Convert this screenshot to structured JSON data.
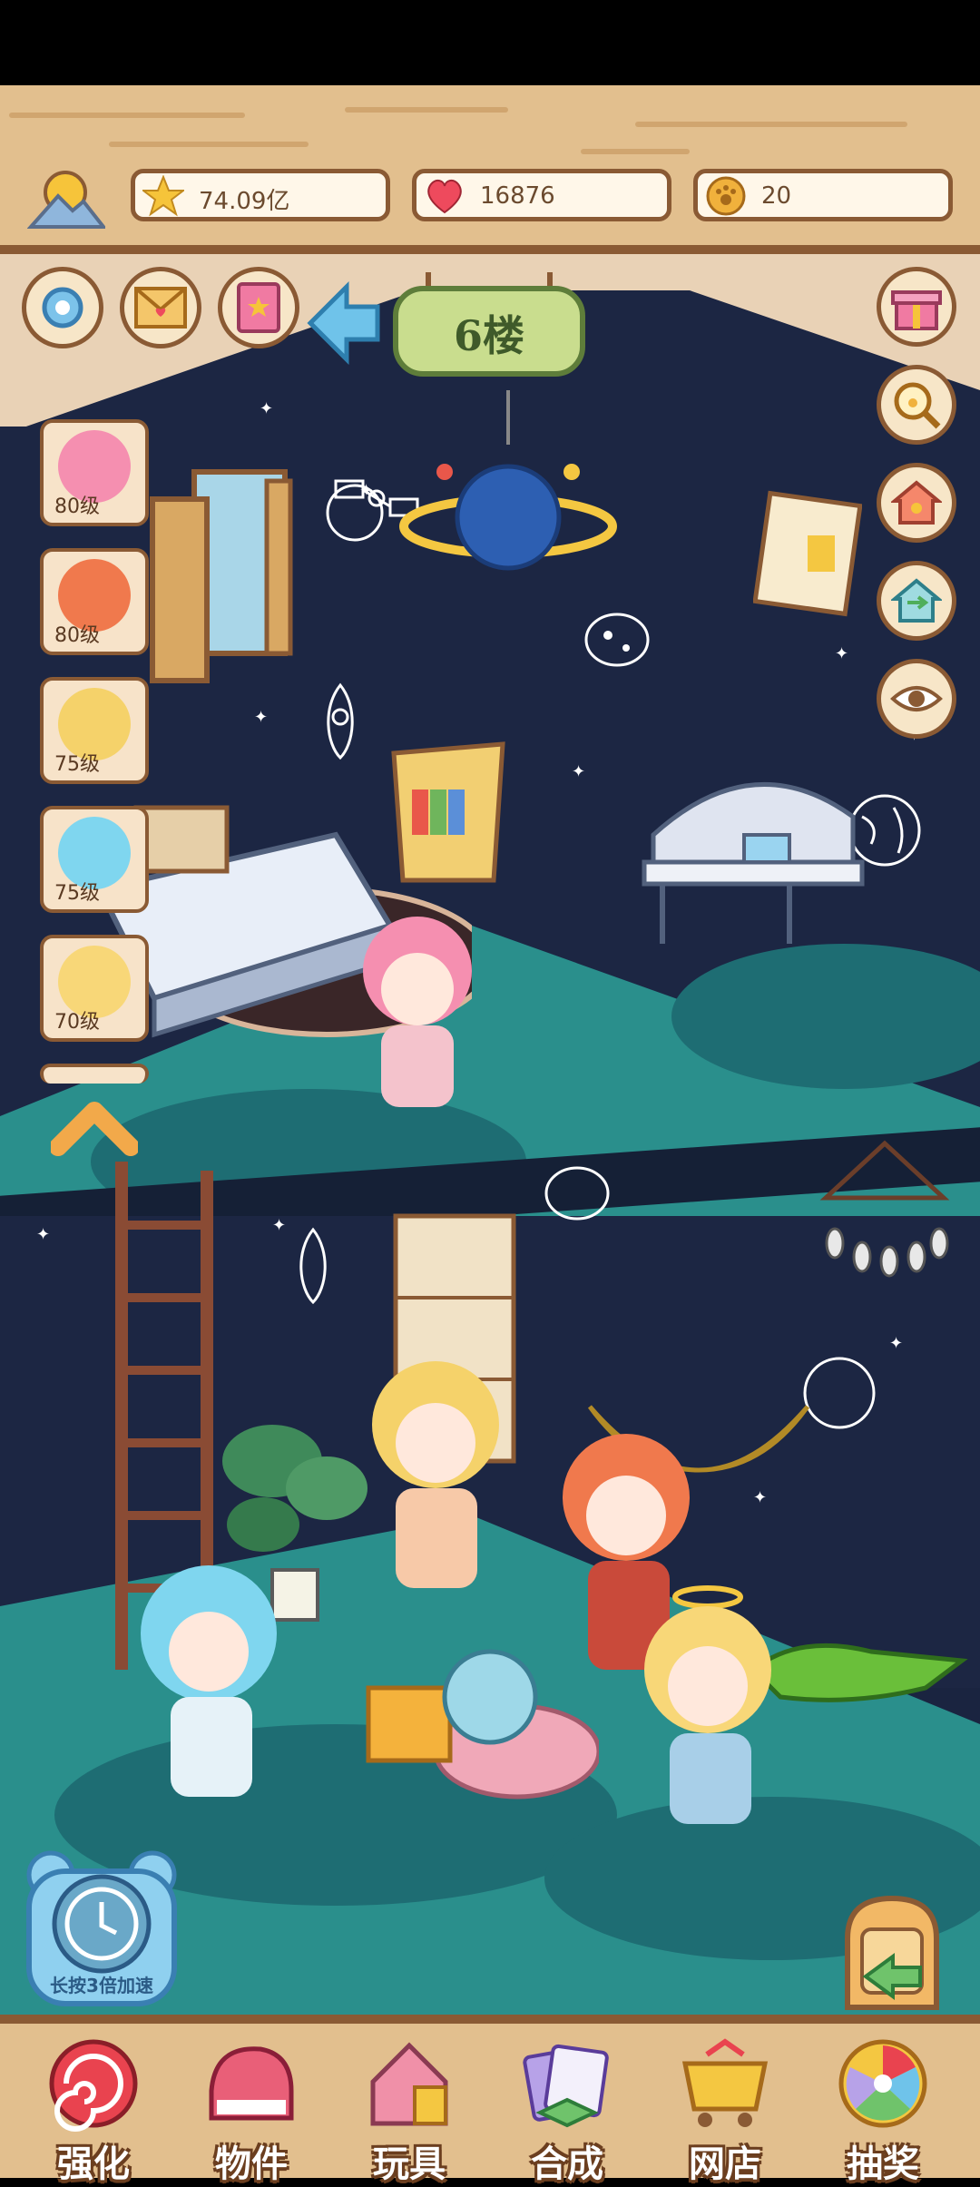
{
  "resources": [
    {
      "name": "stars",
      "icon": "star-icon",
      "value": "74.09亿"
    },
    {
      "name": "hearts",
      "icon": "heart-icon",
      "value": "16876"
    },
    {
      "name": "paw_coins",
      "icon": "paw-coin-icon",
      "value": "20"
    }
  ],
  "floor_sign": "6楼",
  "characters": [
    {
      "level": "80级",
      "hair": "#f58fb0"
    },
    {
      "level": "80级",
      "hair": "#f0794d"
    },
    {
      "level": "75级",
      "hair": "#f5d26a"
    },
    {
      "level": "75级",
      "hair": "#7fd6ef"
    },
    {
      "level": "70级",
      "hair": "#f8d778"
    }
  ],
  "speed_button": "长按3倍加速",
  "bottom_nav": [
    {
      "label": "强化",
      "icon": "swirl-icon"
    },
    {
      "label": "物件",
      "icon": "piano-icon"
    },
    {
      "label": "玩具",
      "icon": "toy-house-icon"
    },
    {
      "label": "合成",
      "icon": "cards-icon"
    },
    {
      "label": "网店",
      "icon": "shop-cart-icon"
    },
    {
      "label": "抽奖",
      "icon": "lottery-wheel-icon"
    }
  ],
  "colors": {
    "wood": "#e2bf8e",
    "wood_dark": "#8a5a34",
    "night_wall": "#1c2643",
    "floor": "#2a8f8c"
  }
}
